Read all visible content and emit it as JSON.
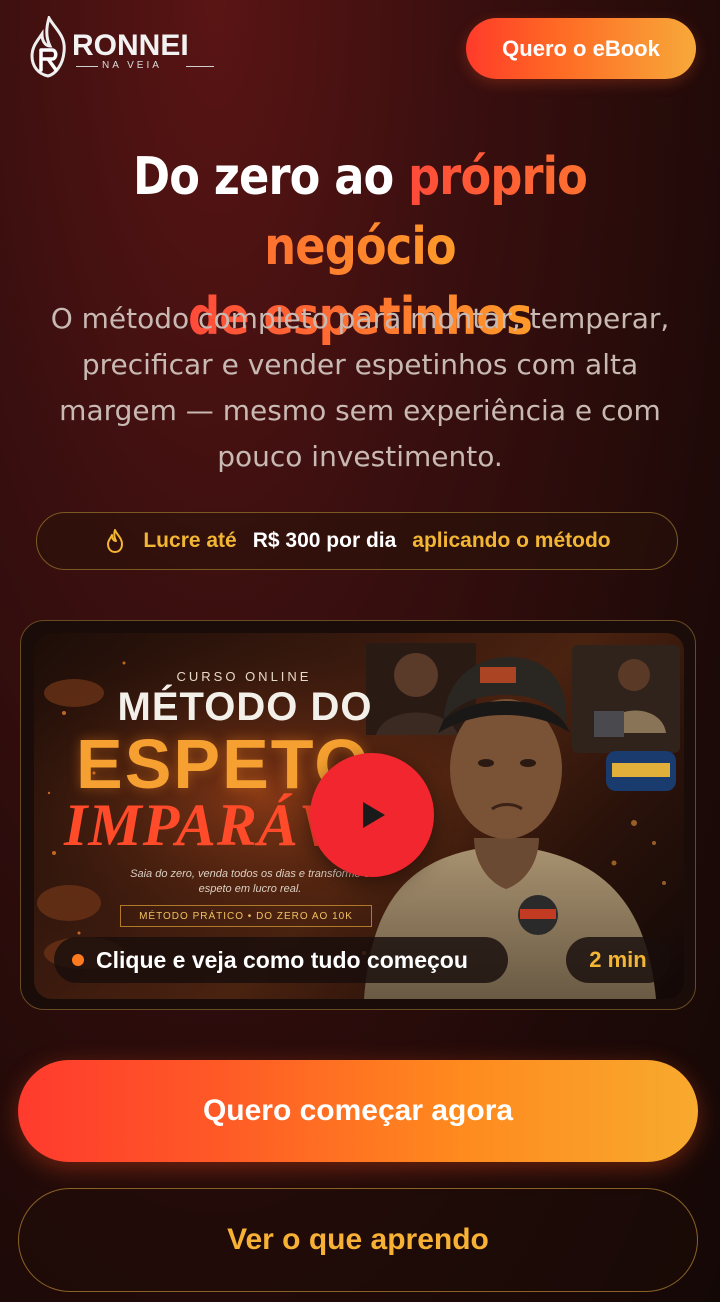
{
  "header": {
    "brand_name": "RONNEI",
    "brand_sub": "NA VEIA",
    "cta_label": "Quero o eBook"
  },
  "hero": {
    "headline_white": "Do zero ao ",
    "headline_orange_1": "próprio negócio",
    "headline_orange_2": "de espetinhos",
    "subtitle": "O método completo para montar, temperar, precificar e vender espetinhos com alta margem — mesmo sem experiência e com pouco investimento."
  },
  "highlight": {
    "icon": "flame-icon",
    "prefix": "Lucre até",
    "amount": "R$ 300 por dia",
    "suffix": "aplicando o método"
  },
  "video": {
    "thumb_label": "CURSO ONLINE",
    "thumb_title_1": "MÉTODO DO",
    "thumb_title_2": "ESPETO",
    "thumb_title_3": "IMPARÁVEL",
    "thumb_desc": "Saia do zero, venda todos os dias e transforme o espeto em lucro real.",
    "thumb_tags": "MÉTODO PRÁTICO • DO ZERO AO 10K",
    "caption": "Clique e veja como tudo começou",
    "duration": "2 min"
  },
  "actions": {
    "primary": "Quero começar agora",
    "secondary": "Ver o que aprendo"
  },
  "colors": {
    "accent_orange": "#ff6a24",
    "accent_gold": "#f3b534",
    "play_red": "#f2262f",
    "background": "#2a0e0a"
  }
}
